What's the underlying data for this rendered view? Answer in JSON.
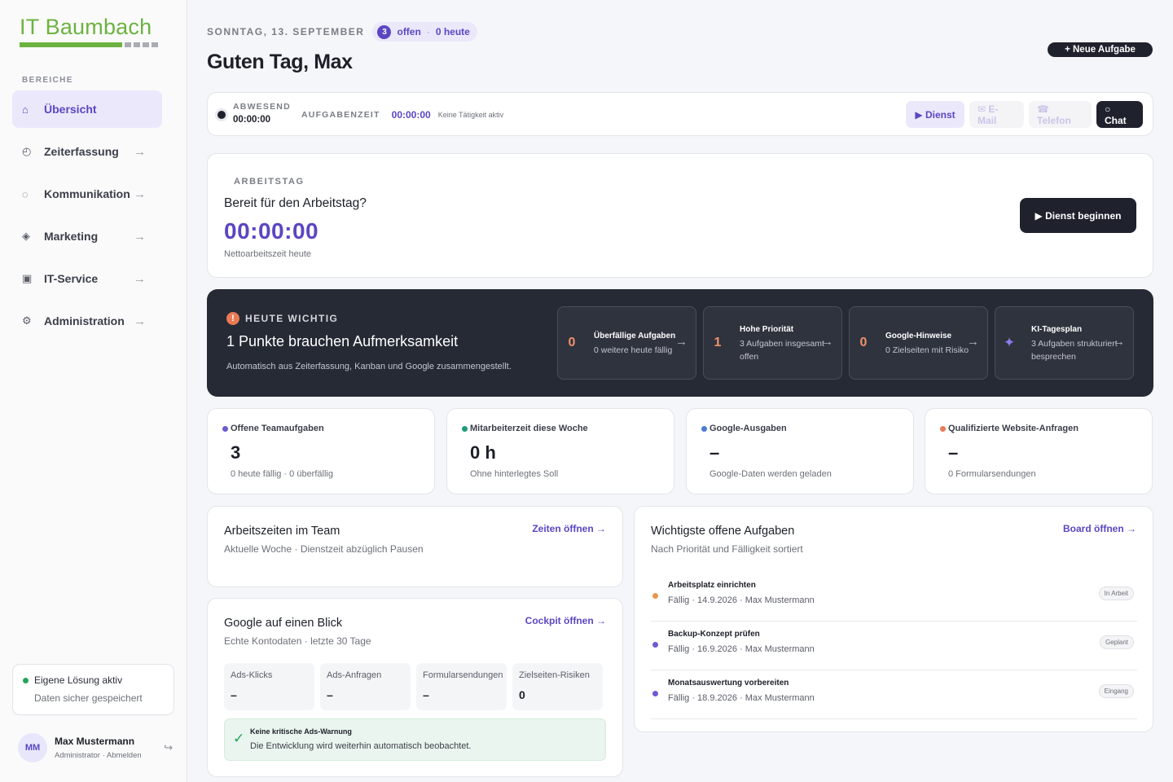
{
  "brand": {
    "name": "IT Baumbach",
    "accent": "#6cb33f"
  },
  "sidebar": {
    "section_label": "BEREICHE",
    "items": [
      {
        "label": "Übersicht",
        "icon": "home-icon",
        "glyph": "⌂",
        "active": true
      },
      {
        "label": "Zeiterfassung",
        "icon": "clock-icon",
        "glyph": "◴",
        "arrow": "→"
      },
      {
        "label": "Kommunikation",
        "icon": "chat-bubble-icon",
        "glyph": "◌",
        "arrow": "→"
      },
      {
        "label": "Marketing",
        "icon": "diamond-icon",
        "glyph": "◈",
        "arrow": "→"
      },
      {
        "label": "IT-Service",
        "icon": "server-icon",
        "glyph": "▣",
        "arrow": "→"
      },
      {
        "label": "Administration",
        "icon": "gear-icon",
        "glyph": "⚙",
        "arrow": "→"
      }
    ],
    "status": {
      "title": "Eigene Lösung aktiv",
      "subtitle": "Daten sicher gespeichert"
    },
    "user": {
      "initials": "MM",
      "name": "Max Mustermann",
      "role": "Administrator · Abmelden",
      "logout_glyph": "↪"
    }
  },
  "header": {
    "date": "SONNTAG, 13. SEPTEMBER",
    "open_count": "3",
    "open_label": "offen",
    "sep": "·",
    "today_label": "0 heute",
    "greeting": "Guten Tag, Max",
    "new_task": "+ Neue Aufgabe"
  },
  "timebar": {
    "status_label": "ABWESEND",
    "status_time": "00:00:00",
    "task_label": "AUFGABENZEIT",
    "task_time": "00:00:00",
    "task_hint": "Keine Tätigkeit aktiv",
    "buttons": {
      "dienst": "▶ Dienst",
      "email": "✉ E-Mail",
      "telefon": "☎ Telefon",
      "chat": "○ Chat"
    }
  },
  "workday": {
    "label": "ARBEITSTAG",
    "question": "Bereit für den Arbeitstag?",
    "time": "00:00:00",
    "subtitle": "Nettoarbeitszeit heute",
    "button": "▶ Dienst beginnen"
  },
  "important": {
    "badge": "!",
    "label": "HEUTE WICHTIG",
    "title": "1 Punkte brauchen Aufmerksamkeit",
    "subtitle": "Automatisch aus Zeiterfassung, Kanban und Google zusammengestellt.",
    "tiles": [
      {
        "value": "0",
        "title": "Überfällige Aufgaben",
        "desc": "0 weitere heute fällig",
        "arrow": "→"
      },
      {
        "value": "1",
        "title": "Hohe Priorität",
        "desc": "3 Aufgaben insgesamt offen",
        "arrow": "→"
      },
      {
        "value": "0",
        "title": "Google-Hinweise",
        "desc": "0 Zielseiten mit Risiko",
        "arrow": "→"
      },
      {
        "value": "✦",
        "title": "KI-Tagesplan",
        "desc": "3 Aufgaben strukturiert besprechen",
        "arrow": "→"
      }
    ]
  },
  "stats": [
    {
      "label": "Offene Teamaufgaben",
      "value": "3",
      "sub": "0 heute fällig · 0 überfällig",
      "color": "#6b5bd2"
    },
    {
      "label": "Mitarbeiterzeit diese Woche",
      "value": "0 h",
      "sub": "Ohne hinterlegtes Soll",
      "color": "#1f9b7a"
    },
    {
      "label": "Google-Ausgaben",
      "value": "–",
      "sub": "Google-Daten werden geladen",
      "color": "#4a7bd6"
    },
    {
      "label": "Qualifizierte Website-Anfragen",
      "value": "–",
      "sub": "0 Formularsendungen",
      "color": "#e87b55"
    }
  ],
  "worktimes": {
    "title": "Arbeitszeiten im Team",
    "subtitle": "Aktuelle Woche · Dienstzeit abzüglich Pausen",
    "link": "Zeiten öffnen →"
  },
  "google": {
    "title": "Google auf einen Blick",
    "subtitle": "Echte Kontodaten · letzte 30 Tage",
    "link": "Cockpit öffnen →",
    "metrics": [
      {
        "label": "Ads-Klicks",
        "value": "–"
      },
      {
        "label": "Ads-Anfragen",
        "value": "–"
      },
      {
        "label": "Formularsendungen",
        "value": "–"
      },
      {
        "label": "Zielseiten-Risiken",
        "value": "0"
      }
    ],
    "notice": {
      "icon": "✓",
      "title": "Keine kritische Ads-Warnung",
      "text": "Die Entwicklung wird weiterhin automatisch beobachtet."
    }
  },
  "tasks": {
    "title": "Wichtigste offene Aufgaben",
    "subtitle": "Nach Priorität und Fälligkeit sortiert",
    "link": "Board öffnen →",
    "items": [
      {
        "name": "Arbeitsplatz einrichten",
        "meta": "Fällig · 14.9.2026 · Max Mustermann",
        "status": "In Arbeit",
        "color": "#e8954f"
      },
      {
        "name": "Backup-Konzept prüfen",
        "meta": "Fällig · 16.9.2026 · Max Mustermann",
        "status": "Geplant",
        "color": "#6b5bd2"
      },
      {
        "name": "Monatsauswertung vorbereiten",
        "meta": "Fällig · 18.9.2026 · Max Mustermann",
        "status": "Eingang",
        "color": "#6b5bd2"
      }
    ]
  }
}
